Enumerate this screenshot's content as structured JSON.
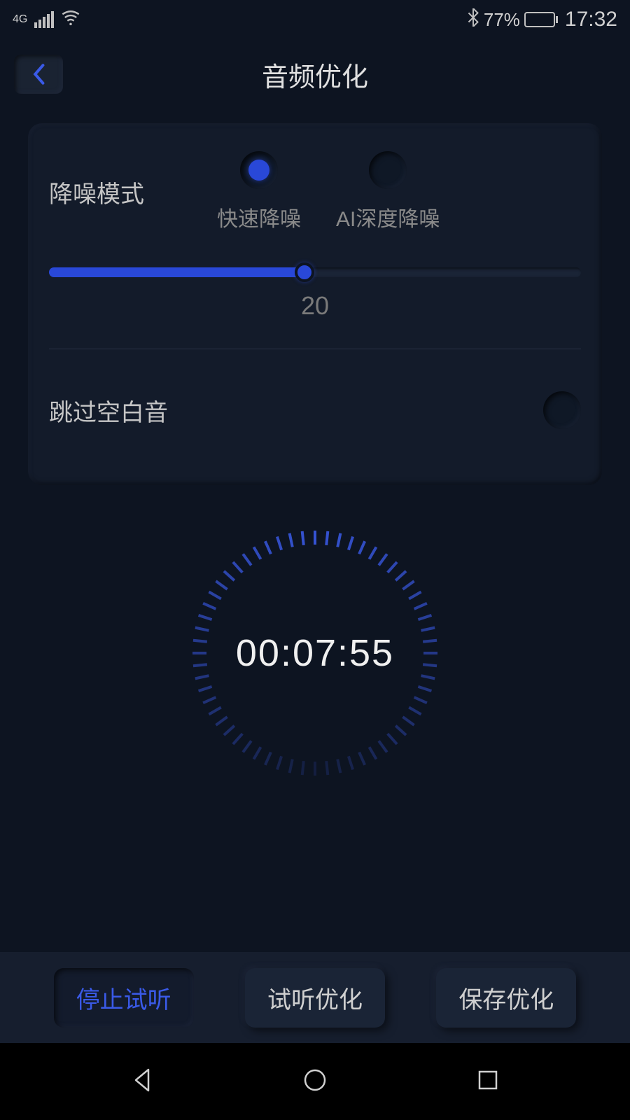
{
  "statusBar": {
    "network": "4G",
    "batteryPercent": "77%",
    "time": "17:32"
  },
  "header": {
    "title": "音频优化"
  },
  "noiseReduction": {
    "label": "降噪模式",
    "options": {
      "fast": "快速降噪",
      "aiDeep": "AI深度降噪"
    },
    "sliderValue": "20"
  },
  "skipSilence": {
    "label": "跳过空白音"
  },
  "timer": {
    "display": "00:07:55"
  },
  "actions": {
    "stopPreview": "停止试听",
    "previewOptimize": "试听优化",
    "saveOptimize": "保存优化"
  }
}
